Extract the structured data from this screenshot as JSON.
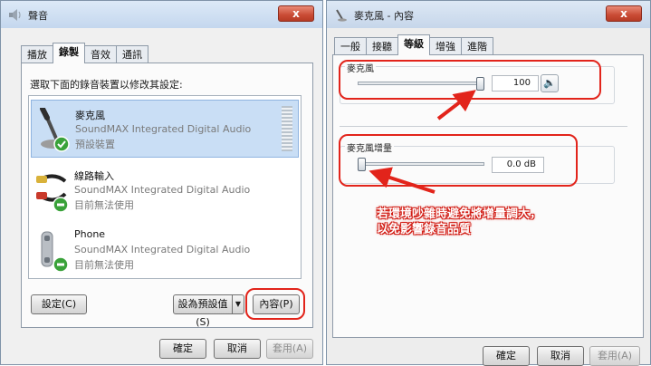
{
  "left_dialog": {
    "title": "聲音",
    "close_label": "x",
    "tabs": [
      {
        "label": "播放"
      },
      {
        "label": "錄製"
      },
      {
        "label": "音效"
      },
      {
        "label": "通訊"
      }
    ],
    "instruction": "選取下面的錄音裝置以修改其設定:",
    "devices": [
      {
        "name": "麥克風",
        "driver": "SoundMAX Integrated Digital Audio",
        "status": "預設裝置",
        "icon": "microphone-icon"
      },
      {
        "name": "線路輸入",
        "driver": "SoundMAX Integrated Digital Audio",
        "status": "目前無法使用",
        "icon": "line-in-cable-icon"
      },
      {
        "name": "Phone",
        "driver": "SoundMAX Integrated Digital Audio",
        "status": "目前無法使用",
        "icon": "phone-handset-icon"
      }
    ],
    "configure_label": "設定(C)",
    "set_default_label": "設為預設值(S)",
    "properties_label": "內容(P)",
    "ok_label": "確定",
    "cancel_label": "取消",
    "apply_label": "套用(A)"
  },
  "right_dialog": {
    "title": "麥克風 - 內容",
    "close_label": "x",
    "tabs": [
      {
        "label": "一般"
      },
      {
        "label": "接聽"
      },
      {
        "label": "等級"
      },
      {
        "label": "增強"
      },
      {
        "label": "進階"
      }
    ],
    "mic_group_label": "麥克風",
    "mic_level_value": "100",
    "mic_level_fraction": 1.0,
    "boost_group_label": "麥克風增量",
    "boost_value": "0.0 dB",
    "boost_fraction": 0.0,
    "ok_label": "確定",
    "cancel_label": "取消",
    "apply_label": "套用(A)"
  },
  "annotation": {
    "line1": "若環境吵雜時避免將增量調大，",
    "line2": "以免影響錄音品質",
    "color": "#e2241b"
  }
}
